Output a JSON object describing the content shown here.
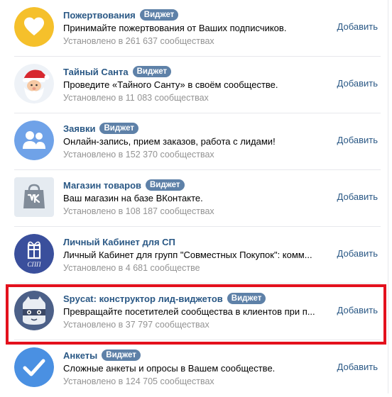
{
  "badge_label": "Виджет",
  "add_label": "Добавить",
  "items": [
    {
      "title": "Пожертвования",
      "has_badge": true,
      "description": "Принимайте пожертвования от Ваших подписчиков.",
      "installed": "Установлено в 261 637 сообществах",
      "icon": "heart-icon"
    },
    {
      "title": "Тайный Санта",
      "has_badge": true,
      "description": "Проведите «Тайного Санту» в своём сообществе.",
      "installed": "Установлено в 11 083 сообществах",
      "icon": "santa-icon"
    },
    {
      "title": "Заявки",
      "has_badge": true,
      "description": "Онлайн-запись, прием заказов, работа с лидами!",
      "installed": "Установлено в 152 370 сообществах",
      "icon": "users-icon"
    },
    {
      "title": "Магазин товаров",
      "has_badge": true,
      "description": "Ваш магазин на базе ВКонтакте.",
      "installed": "Установлено в 108 187 сообществах",
      "icon": "vk-shopping-bag-icon"
    },
    {
      "title": "Личный Кабинет для СП",
      "has_badge": false,
      "description": "Личный Кабинет для групп \"Совместных Покупок\": комм...",
      "installed": "Установлено в 4 681 сообществе",
      "icon": "gift-box-icon",
      "logo_text": "СПП"
    },
    {
      "title": "Spycat: конструктор лид-виджетов",
      "has_badge": true,
      "description": "Превращайте посетителей сообщества в клиентов при п...",
      "installed": "Установлено в 37 797 сообществах",
      "icon": "spy-cat-icon"
    },
    {
      "title": "Анкеты",
      "has_badge": true,
      "description": "Сложные анкеты и опросы в Вашем сообществе.",
      "installed": "Установлено в 124 705 сообществах",
      "icon": "checkmark-icon"
    }
  ],
  "colors": {
    "link": "#2a5885",
    "badge_bg": "#5e81a8",
    "meta": "#939393",
    "highlight": "#e3111d",
    "donate": "#f5c02b",
    "requests": "#6fa2e8",
    "shop": "#e5ebf1",
    "sp": "#3a4f9c",
    "forms": "#4a90e2"
  }
}
